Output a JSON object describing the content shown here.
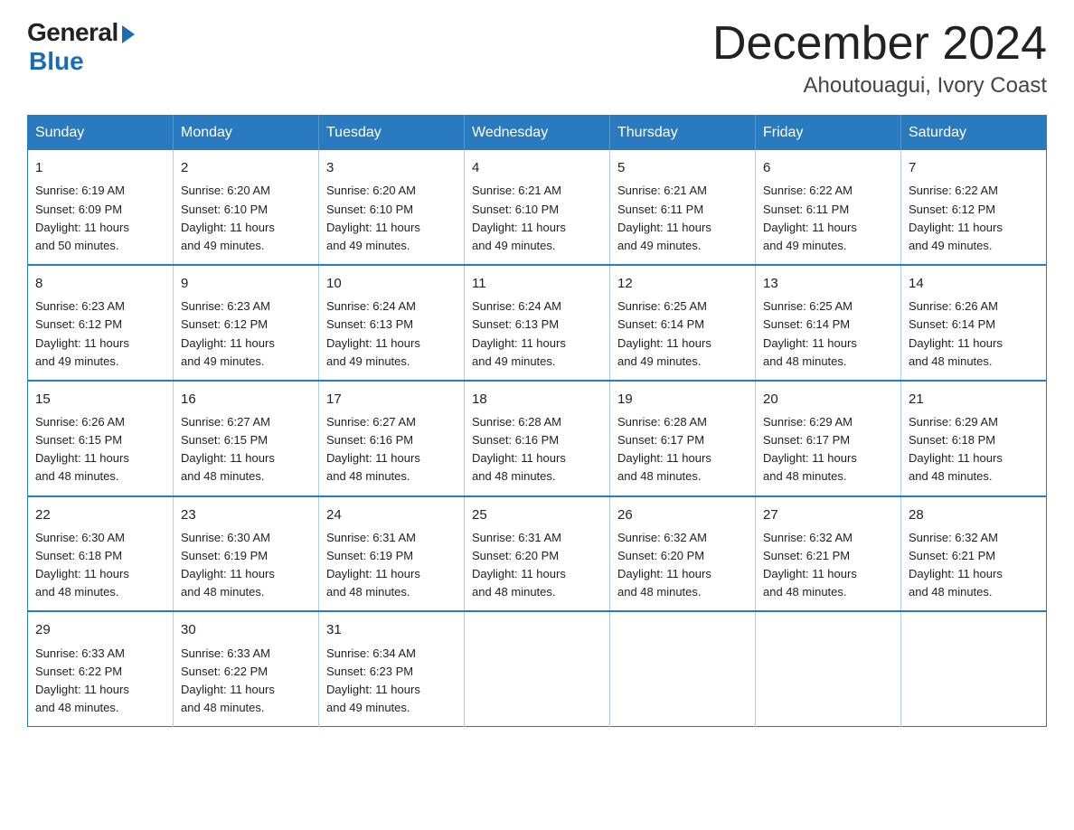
{
  "logo": {
    "general": "General",
    "blue": "Blue"
  },
  "header": {
    "month_title": "December 2024",
    "location": "Ahoutouagui, Ivory Coast"
  },
  "days_of_week": [
    "Sunday",
    "Monday",
    "Tuesday",
    "Wednesday",
    "Thursday",
    "Friday",
    "Saturday"
  ],
  "weeks": [
    [
      {
        "day": "1",
        "sunrise": "6:19 AM",
        "sunset": "6:09 PM",
        "daylight": "11 hours and 50 minutes."
      },
      {
        "day": "2",
        "sunrise": "6:20 AM",
        "sunset": "6:10 PM",
        "daylight": "11 hours and 49 minutes."
      },
      {
        "day": "3",
        "sunrise": "6:20 AM",
        "sunset": "6:10 PM",
        "daylight": "11 hours and 49 minutes."
      },
      {
        "day": "4",
        "sunrise": "6:21 AM",
        "sunset": "6:10 PM",
        "daylight": "11 hours and 49 minutes."
      },
      {
        "day": "5",
        "sunrise": "6:21 AM",
        "sunset": "6:11 PM",
        "daylight": "11 hours and 49 minutes."
      },
      {
        "day": "6",
        "sunrise": "6:22 AM",
        "sunset": "6:11 PM",
        "daylight": "11 hours and 49 minutes."
      },
      {
        "day": "7",
        "sunrise": "6:22 AM",
        "sunset": "6:12 PM",
        "daylight": "11 hours and 49 minutes."
      }
    ],
    [
      {
        "day": "8",
        "sunrise": "6:23 AM",
        "sunset": "6:12 PM",
        "daylight": "11 hours and 49 minutes."
      },
      {
        "day": "9",
        "sunrise": "6:23 AM",
        "sunset": "6:12 PM",
        "daylight": "11 hours and 49 minutes."
      },
      {
        "day": "10",
        "sunrise": "6:24 AM",
        "sunset": "6:13 PM",
        "daylight": "11 hours and 49 minutes."
      },
      {
        "day": "11",
        "sunrise": "6:24 AM",
        "sunset": "6:13 PM",
        "daylight": "11 hours and 49 minutes."
      },
      {
        "day": "12",
        "sunrise": "6:25 AM",
        "sunset": "6:14 PM",
        "daylight": "11 hours and 49 minutes."
      },
      {
        "day": "13",
        "sunrise": "6:25 AM",
        "sunset": "6:14 PM",
        "daylight": "11 hours and 48 minutes."
      },
      {
        "day": "14",
        "sunrise": "6:26 AM",
        "sunset": "6:14 PM",
        "daylight": "11 hours and 48 minutes."
      }
    ],
    [
      {
        "day": "15",
        "sunrise": "6:26 AM",
        "sunset": "6:15 PM",
        "daylight": "11 hours and 48 minutes."
      },
      {
        "day": "16",
        "sunrise": "6:27 AM",
        "sunset": "6:15 PM",
        "daylight": "11 hours and 48 minutes."
      },
      {
        "day": "17",
        "sunrise": "6:27 AM",
        "sunset": "6:16 PM",
        "daylight": "11 hours and 48 minutes."
      },
      {
        "day": "18",
        "sunrise": "6:28 AM",
        "sunset": "6:16 PM",
        "daylight": "11 hours and 48 minutes."
      },
      {
        "day": "19",
        "sunrise": "6:28 AM",
        "sunset": "6:17 PM",
        "daylight": "11 hours and 48 minutes."
      },
      {
        "day": "20",
        "sunrise": "6:29 AM",
        "sunset": "6:17 PM",
        "daylight": "11 hours and 48 minutes."
      },
      {
        "day": "21",
        "sunrise": "6:29 AM",
        "sunset": "6:18 PM",
        "daylight": "11 hours and 48 minutes."
      }
    ],
    [
      {
        "day": "22",
        "sunrise": "6:30 AM",
        "sunset": "6:18 PM",
        "daylight": "11 hours and 48 minutes."
      },
      {
        "day": "23",
        "sunrise": "6:30 AM",
        "sunset": "6:19 PM",
        "daylight": "11 hours and 48 minutes."
      },
      {
        "day": "24",
        "sunrise": "6:31 AM",
        "sunset": "6:19 PM",
        "daylight": "11 hours and 48 minutes."
      },
      {
        "day": "25",
        "sunrise": "6:31 AM",
        "sunset": "6:20 PM",
        "daylight": "11 hours and 48 minutes."
      },
      {
        "day": "26",
        "sunrise": "6:32 AM",
        "sunset": "6:20 PM",
        "daylight": "11 hours and 48 minutes."
      },
      {
        "day": "27",
        "sunrise": "6:32 AM",
        "sunset": "6:21 PM",
        "daylight": "11 hours and 48 minutes."
      },
      {
        "day": "28",
        "sunrise": "6:32 AM",
        "sunset": "6:21 PM",
        "daylight": "11 hours and 48 minutes."
      }
    ],
    [
      {
        "day": "29",
        "sunrise": "6:33 AM",
        "sunset": "6:22 PM",
        "daylight": "11 hours and 48 minutes."
      },
      {
        "day": "30",
        "sunrise": "6:33 AM",
        "sunset": "6:22 PM",
        "daylight": "11 hours and 48 minutes."
      },
      {
        "day": "31",
        "sunrise": "6:34 AM",
        "sunset": "6:23 PM",
        "daylight": "11 hours and 49 minutes."
      },
      null,
      null,
      null,
      null
    ]
  ],
  "labels": {
    "sunrise": "Sunrise:",
    "sunset": "Sunset:",
    "daylight": "Daylight:"
  }
}
